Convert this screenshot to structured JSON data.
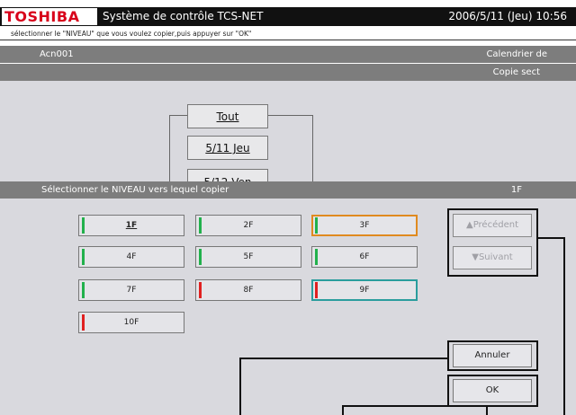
{
  "brand": "TOSHIBA",
  "app_title": "Système de contrôle TCS-NET",
  "datetime": "2006/5/11 (Jeu) 10:56",
  "instruction": "sélectionner le \"NIVEAU\" que vous voulez copier,puis appuyer sur \"OK\"",
  "unit_name": "Acn001",
  "calendar_label": "Calendrier de",
  "copy_label": "Copie sect",
  "day_buttons": [
    "Tout",
    "5/11 Jeu",
    "5/12 Ven"
  ],
  "panel": {
    "title": "Sélectionner le NIVEAU vers lequel copier",
    "current_level": "1F"
  },
  "floors": [
    {
      "label": "1F",
      "mark": "green"
    },
    {
      "label": "2F",
      "mark": "green"
    },
    {
      "label": "3F",
      "mark": "green"
    },
    {
      "label": "4F",
      "mark": "green"
    },
    {
      "label": "5F",
      "mark": "green"
    },
    {
      "label": "6F",
      "mark": "green"
    },
    {
      "label": "7F",
      "mark": "green"
    },
    {
      "label": "8F",
      "mark": "red"
    },
    {
      "label": "9F",
      "mark": "red"
    },
    {
      "label": "10F",
      "mark": "red"
    }
  ],
  "nav": {
    "prev": "▲Précédent",
    "next": "▼Suivant"
  },
  "actions": {
    "cancel": "Annuler",
    "ok": "OK"
  },
  "colors": {
    "mark_green": "#22b14c",
    "mark_red": "#e02020",
    "selected_border": "#e08a1f",
    "teal_border": "#2a9d9d",
    "brand_red": "#d8001a"
  }
}
